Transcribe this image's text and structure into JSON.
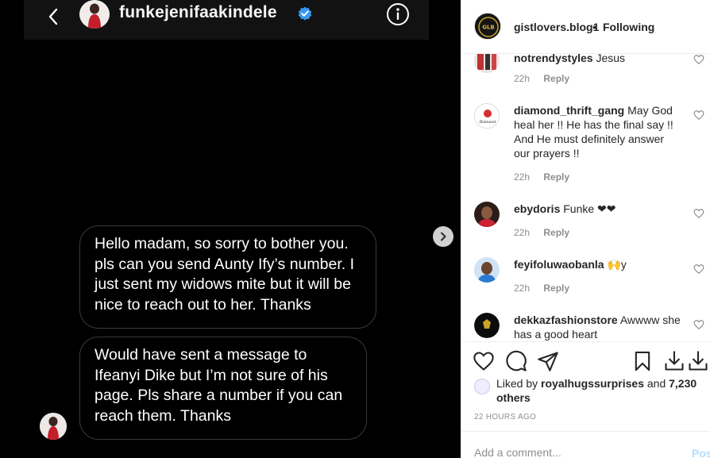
{
  "dm": {
    "username": "funkejenifaakindele",
    "icons": {
      "back": "chevron-left-icon",
      "verified": "verified-badge-icon",
      "info": "info-icon"
    },
    "messages": [
      {
        "text": "Hello madam, so sorry to bother you. pls can you send Aunty Ify’s number. I just sent my widows mite but it will be nice to reach out to her. Thanks"
      },
      {
        "text": "Would have sent a message to Ifeanyi Dike but I’m not sure of his page. Pls share a number if you can reach them. Thanks"
      }
    ]
  },
  "post_header": {
    "username": "gistlovers.blog1",
    "separator": "•",
    "following_label": "Following",
    "avatar_text": "GLB"
  },
  "comments": [
    {
      "username": "notrendystyles",
      "text": "Jesus",
      "time": "22h",
      "reply_label": "Reply"
    },
    {
      "username": "diamond_thrift_gang",
      "text": "May God heal her !! He has the final say !! And He must definitely answer our prayers !!",
      "time": "22h",
      "reply_label": "Reply",
      "avatar_text": "Diamond"
    },
    {
      "username": "ebydoris",
      "text": "Funke ❤❤",
      "time": "22h",
      "reply_label": "Reply"
    },
    {
      "username": "feyifoluwaobanla",
      "text": "🙌y",
      "time": "22h",
      "reply_label": "Reply"
    },
    {
      "username": "dekkazfashionstore",
      "text": "Awwww she has a good heart",
      "time": "",
      "reply_label": ""
    }
  ],
  "actions": {
    "icons": [
      "heart-icon",
      "comment-icon",
      "share-icon",
      "bookmark-icon",
      "download-icon",
      "download-icon"
    ]
  },
  "likes": {
    "prefix": "Liked by ",
    "user": "royalhugssurprises",
    "middle": " and ",
    "others": "7,230 others"
  },
  "timestamp": "22 HOURS AGO",
  "add_comment": {
    "placeholder": "Add a comment...",
    "post_label": "Post"
  },
  "colors": {
    "accent": "#0095f6",
    "verified": "#3897f0",
    "heart": "#e0131f",
    "post_disabled": "#b2dffc"
  }
}
